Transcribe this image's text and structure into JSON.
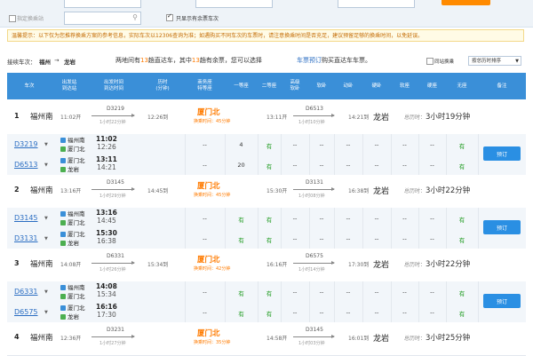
{
  "top": {
    "only_check_label": "只显示有余票车次",
    "left_hint": "指定换乘站",
    "accent": "#ff8a00"
  },
  "notice": {
    "text": "温馨提示：以下仅为您推荐换乘方案的参考信息，实际车次以12306查询为准；如遇购买不同车次的车票时，请注意换乘时间是否充足，建议预留足够的换乘时间，以免延误。"
  },
  "route": {
    "prefix": "接续车次：",
    "from": "福州",
    "arrow": "→",
    "to": "龙岩",
    "info_pre": "两地间有",
    "count": "13",
    "info_mid": "趟直达车，其中",
    "count2": "13",
    "info_post": "趟有余票，您可以选择",
    "link": "车票预订",
    "info_end": "购买直达车车票。",
    "transfer_check": "同站换乘",
    "sort_select": "按总历时排序"
  },
  "headers": [
    "车次",
    "出发站\n到达站",
    "出发时间\n到达时间",
    "历时\n(分钟)",
    "商务座\n特等座",
    "一等座",
    "二等座",
    "高级\n软卧",
    "软卧",
    "动卧",
    "硬卧",
    "软座",
    "硬座",
    "无座",
    "备注"
  ],
  "colors": {
    "header_bg": "#3a8fd8",
    "have": "#1f9b1f",
    "transfer": "#ff7b00",
    "book": "#2a8fe3"
  },
  "plans": [
    {
      "no": "1",
      "from": "福州南",
      "dep": "11:02开",
      "train1": "D3219",
      "dur1": "1小时22分钟",
      "arr1": "12:26到",
      "transfer": "厦门北",
      "wait": "换乘时间：45分钟",
      "dep2": "13:11开",
      "train2": "D6513",
      "dur2": "1小时10分钟",
      "arr2": "14:21到",
      "to": "龙岩",
      "total_label": "总历时：",
      "total": "3小时19分钟",
      "legs": [
        {
          "train": "D3219",
          "s1": "福州南",
          "s2": "厦门北",
          "t1": "11:02",
          "t2": "12:26",
          "first": "4",
          "second": "有",
          "none": "有"
        },
        {
          "train": "D6513",
          "s1": "厦门北",
          "s2": "龙岩",
          "t1": "13:11",
          "t2": "14:21",
          "first": "20",
          "second": "有",
          "none": "有"
        }
      ]
    },
    {
      "no": "2",
      "from": "福州南",
      "dep": "13:16开",
      "train1": "D3145",
      "dur1": "1小时29分钟",
      "arr1": "14:45到",
      "transfer": "厦门北",
      "wait": "换乘时间：45分钟",
      "dep2": "15:30开",
      "train2": "D3131",
      "dur2": "1小时08分钟",
      "arr2": "16:38到",
      "to": "龙岩",
      "total_label": "总历时：",
      "total": "3小时22分钟",
      "legs": [
        {
          "train": "D3145",
          "s1": "福州南",
          "s2": "厦门北",
          "t1": "13:16",
          "t2": "14:45",
          "first": "有",
          "second": "有",
          "none": "有"
        },
        {
          "train": "D3131",
          "s1": "厦门北",
          "s2": "龙岩",
          "t1": "15:30",
          "t2": "16:38",
          "first": "有",
          "second": "有",
          "none": "有"
        }
      ]
    },
    {
      "no": "3",
      "from": "福州南",
      "dep": "14:08开",
      "train1": "D6331",
      "dur1": "1小时26分钟",
      "arr1": "15:34到",
      "transfer": "厦门北",
      "wait": "换乘时间：42分钟",
      "dep2": "16:16开",
      "train2": "D6575",
      "dur2": "1小时14分钟",
      "arr2": "17:30到",
      "to": "龙岩",
      "total_label": "总历时：",
      "total": "3小时22分钟",
      "legs": [
        {
          "train": "D6331",
          "s1": "福州南",
          "s2": "厦门北",
          "t1": "14:08",
          "t2": "15:34",
          "first": "有",
          "second": "有",
          "none": "有"
        },
        {
          "train": "D6575",
          "s1": "厦门北",
          "s2": "龙岩",
          "t1": "16:16",
          "t2": "17:30",
          "first": "有",
          "second": "有",
          "none": "有"
        }
      ]
    },
    {
      "no": "4",
      "from": "福州南",
      "dep": "12:36开",
      "train1": "D3231",
      "dur1": "1小时27分钟",
      "arr1": "",
      "transfer": "厦门北",
      "wait": "换乘时间：35分钟",
      "dep2": "14:58开",
      "train2": "D3145",
      "dur2": "1小时03分钟",
      "arr2": "16:01到",
      "to": "龙岩",
      "total_label": "总历时：",
      "total": "3小时25分钟",
      "legs": []
    }
  ],
  "book_label": "预订",
  "dash": "--"
}
